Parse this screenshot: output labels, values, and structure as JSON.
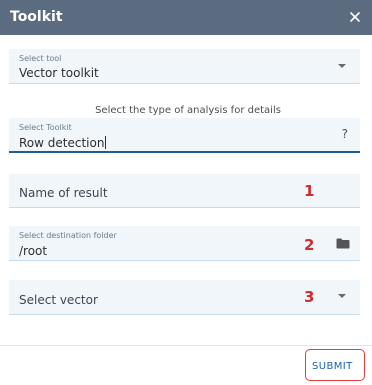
{
  "dialog": {
    "title": "Toolkit",
    "close_icon": "close-icon"
  },
  "select_tool": {
    "label": "Select tool",
    "value": "Vector toolkit"
  },
  "hint_text": "Select the type of analysis for details",
  "select_toolkit": {
    "label": "Select Toolkit",
    "value": "Row detection",
    "help": "?"
  },
  "name_of_result": {
    "placeholder": "Name of result",
    "annotation": "1"
  },
  "destination_folder": {
    "label": "Select destination folder",
    "value": "/root",
    "annotation": "2",
    "icon": "folder-icon"
  },
  "select_vector": {
    "placeholder": "Select vector",
    "annotation": "3"
  },
  "footer": {
    "submit_label": "SUBMIT"
  },
  "colors": {
    "header_bg": "#5b6c80",
    "field_bg": "#f1f6fb",
    "accent": "#1b5f92",
    "annotation_red": "#d12c2c"
  }
}
